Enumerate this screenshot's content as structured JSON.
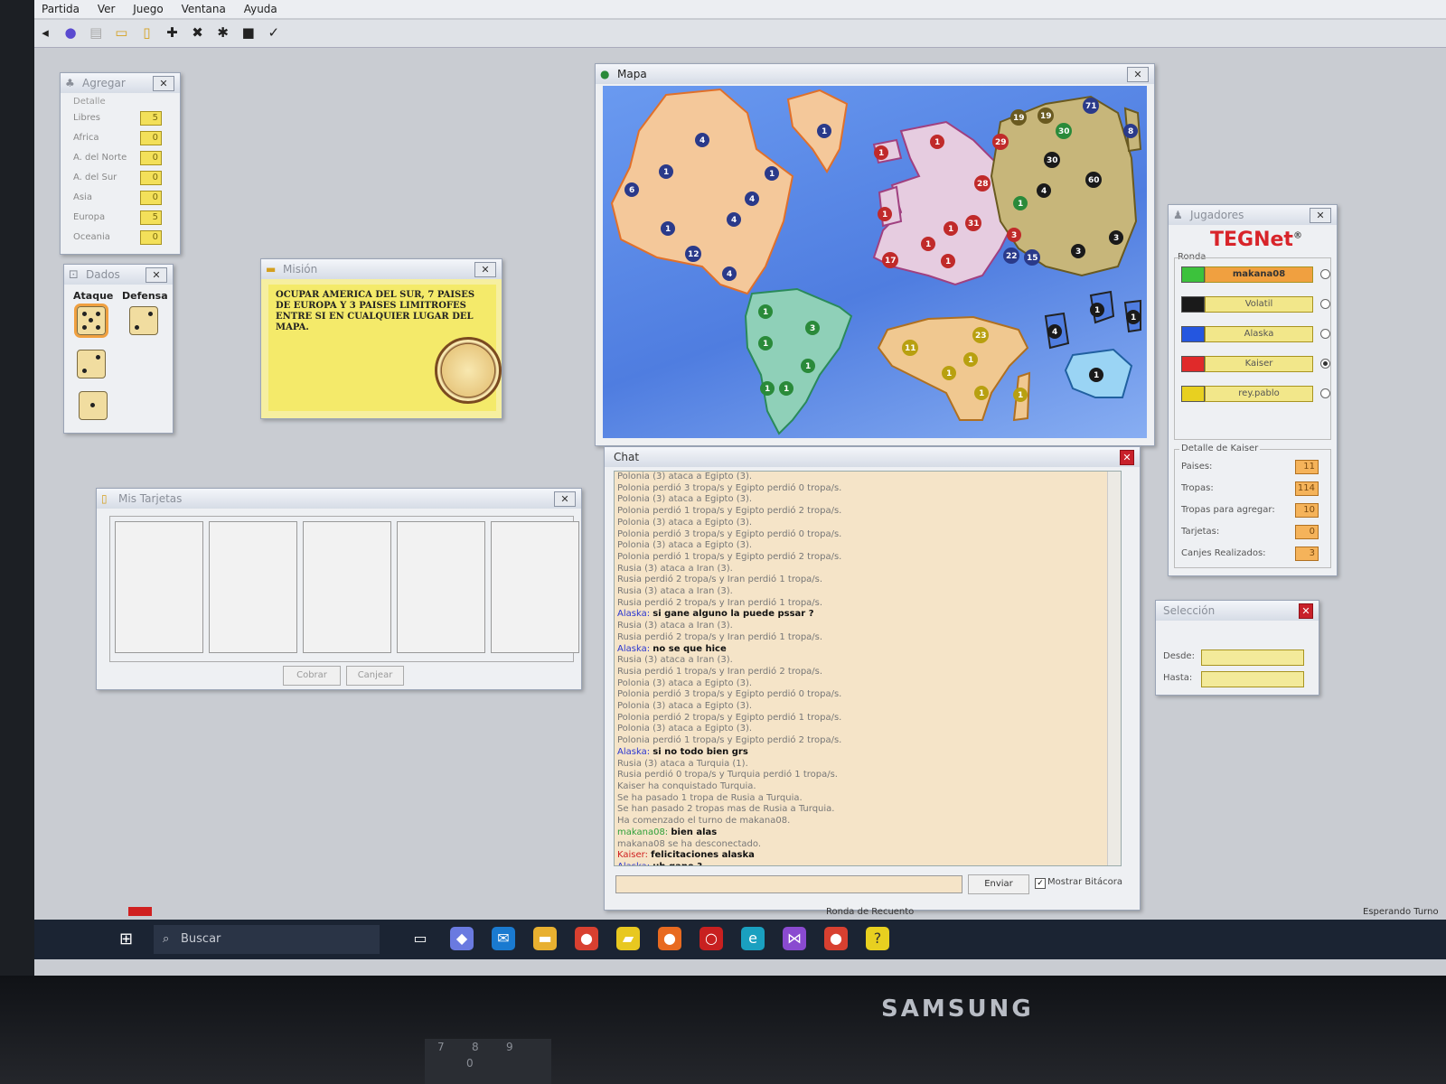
{
  "menu": [
    "Partida",
    "Ver",
    "Juego",
    "Ventana",
    "Ayuda"
  ],
  "toolbar_icons": [
    "back-icon",
    "globe-icon",
    "list-icon",
    "folder-icon",
    "card-icon",
    "plus-icon",
    "cross-icon",
    "gear-icon",
    "stop-icon",
    "check-icon"
  ],
  "agregar": {
    "title": "Agregar",
    "group": "Detalle",
    "rows": [
      {
        "label": "Libres",
        "value": "5"
      },
      {
        "label": "Africa",
        "value": "0"
      },
      {
        "label": "A. del Norte",
        "value": "0"
      },
      {
        "label": "A. del Sur",
        "value": "0"
      },
      {
        "label": "Asia",
        "value": "0"
      },
      {
        "label": "Europa",
        "value": "5"
      },
      {
        "label": "Oceania",
        "value": "0"
      }
    ]
  },
  "dados": {
    "title": "Dados",
    "ataque": "Ataque",
    "defensa": "Defensa"
  },
  "mision": {
    "title": "Misión",
    "text": "OCUPAR AMERICA DEL SUR, 7 PAISES DE EUROPA Y 3 PAISES LIMITROFES ENTRE SI EN CUALQUIER LUGAR DEL MAPA."
  },
  "tarjetas": {
    "title": "Mis Tarjetas",
    "cobrar": "Cobrar",
    "canjear": "Canjear"
  },
  "mapa": {
    "title": "Mapa"
  },
  "jugadores": {
    "title": "Jugadores",
    "logo": "TEGNet",
    "logo_mark": "®",
    "group": "Ronda",
    "players": [
      {
        "name": "makana08",
        "color": "#3cc23c",
        "active": true
      },
      {
        "name": "Volatil",
        "color": "#1a1a1a",
        "active": false
      },
      {
        "name": "Alaska",
        "color": "#2456e0",
        "active": false
      },
      {
        "name": "Kaiser",
        "color": "#e02a2a",
        "active": false
      },
      {
        "name": "rey.pablo",
        "color": "#e8d020",
        "active": false
      }
    ],
    "detalle_title": "Detalle de Kaiser",
    "detalle": [
      {
        "label": "Paises:",
        "value": "11"
      },
      {
        "label": "Tropas:",
        "value": "114"
      },
      {
        "label": "Tropas para agregar:",
        "value": "10"
      },
      {
        "label": "Tarjetas:",
        "value": "0"
      },
      {
        "label": "Canjes Realizados:",
        "value": "3"
      }
    ]
  },
  "seleccion": {
    "title": "Selección",
    "desde": "Desde:",
    "hasta": "Hasta:"
  },
  "chat": {
    "title": "Chat",
    "enviar": "Enviar",
    "mostrar": "Mostrar Bitácora",
    "lines": [
      {
        "t": "Polonia (3) ataca a Egipto (3)."
      },
      {
        "t": "Polonia perdió 3 tropa/s y Egipto perdió 0 tropa/s."
      },
      {
        "t": "Polonia (3) ataca a Egipto (3)."
      },
      {
        "t": "Polonia perdió 1 tropa/s y Egipto perdió 2 tropa/s."
      },
      {
        "t": "Polonia (3) ataca a Egipto (3)."
      },
      {
        "t": "Polonia perdió 3 tropa/s y Egipto perdió 0 tropa/s."
      },
      {
        "t": "Polonia (3) ataca a Egipto (3)."
      },
      {
        "t": "Polonia perdió 1 tropa/s y Egipto perdió 2 tropa/s."
      },
      {
        "t": "Rusia (3) ataca a Iran (3)."
      },
      {
        "t": "Rusia perdió 2 tropa/s y Iran perdió 1 tropa/s."
      },
      {
        "t": "Rusia (3) ataca a Iran (3)."
      },
      {
        "t": "Rusia perdió 2 tropa/s y Iran perdió 1 tropa/s."
      },
      {
        "who": "Alaska:",
        "cls": "who-alaska",
        "msg": "si gane alguno la puede pssar ?"
      },
      {
        "t": "Rusia (3) ataca a Iran (3)."
      },
      {
        "t": "Rusia perdió 2 tropa/s y Iran perdió 1 tropa/s."
      },
      {
        "who": "Alaska:",
        "cls": "who-alaska",
        "msg": "no se que hice"
      },
      {
        "t": "Rusia (3) ataca a Iran (3)."
      },
      {
        "t": "Rusia perdió 1 tropa/s y Iran perdió 2 tropa/s."
      },
      {
        "t": "Polonia (3) ataca a Egipto (3)."
      },
      {
        "t": "Polonia perdió 3 tropa/s y Egipto perdió 0 tropa/s."
      },
      {
        "t": "Polonia (3) ataca a Egipto (3)."
      },
      {
        "t": "Polonia perdió 2 tropa/s y Egipto perdió 1 tropa/s."
      },
      {
        "t": "Polonia (3) ataca a Egipto (3)."
      },
      {
        "t": "Polonia perdió 1 tropa/s y Egipto perdió 2 tropa/s."
      },
      {
        "who": "Alaska:",
        "cls": "who-alaska",
        "msg": "si no todo bien grs"
      },
      {
        "t": "Rusia (3) ataca a Turquia (1)."
      },
      {
        "t": "Rusia perdió 0 tropa/s y Turquia perdió 1 tropa/s."
      },
      {
        "t": "Kaiser ha conquistado Turquia."
      },
      {
        "t": "Se ha pasado 1 tropa de Rusia a Turquia."
      },
      {
        "t": "Se han pasado 2 tropas mas de Rusia a Turquia."
      },
      {
        "t": "Ha comenzado el turno de makana08."
      },
      {
        "who": "makana08:",
        "cls": "who-makana",
        "msg": "bien alas"
      },
      {
        "t": "makana08 se ha desconectado."
      },
      {
        "who": "Kaiser:",
        "cls": "who-kaiser",
        "msg": "felicitaciones alaska"
      },
      {
        "who": "Alaska:",
        "cls": "who-alaska",
        "msg": "uh gane ?"
      }
    ]
  },
  "status": {
    "center": "Ronda de Recuento",
    "right": "Esperando Turno"
  },
  "taskbar": {
    "search": "Buscar"
  },
  "monitor": {
    "brand": "SAMSUNG"
  },
  "keypad": [
    "7",
    "8",
    "9",
    "0"
  ]
}
